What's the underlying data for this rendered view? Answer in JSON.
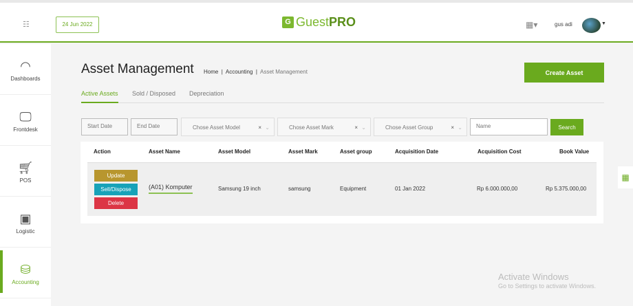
{
  "header": {
    "date": "24 Jun 2022",
    "logo": {
      "prefix": "G",
      "guest": "Guest",
      "pro": "PRO"
    },
    "user": "gus adi"
  },
  "sidebar": {
    "items": [
      {
        "label": "Dashboards",
        "icon": "gauge-icon"
      },
      {
        "label": "Frontdesk",
        "icon": "monitor-icon"
      },
      {
        "label": "POS",
        "icon": "cart-icon"
      },
      {
        "label": "Logistic",
        "icon": "box-icon"
      },
      {
        "label": "Accounting",
        "icon": "money-icon",
        "active": true
      }
    ]
  },
  "page": {
    "title": "Asset Management",
    "breadcrumb": [
      "Home",
      "Accounting",
      "Asset Management"
    ],
    "create_label": "Create Asset"
  },
  "tabs": [
    "Active Assets",
    "Sold / Disposed",
    "Depreciation"
  ],
  "filters": {
    "start_date": "Start Date",
    "end_date": "End Date",
    "model": "Chose Asset Model",
    "mark": "Chose Asset Mark",
    "group": "Chose Asset Group",
    "name": "Name",
    "search": "Search"
  },
  "table": {
    "headers": [
      "Action",
      "Asset Name",
      "Asset Model",
      "Asset Mark",
      "Asset group",
      "Acquisition Date",
      "Acquisition Cost",
      "Book Value"
    ],
    "rows": [
      {
        "actions": [
          "Update",
          "Sell/Dispose",
          "Delete"
        ],
        "name": "(A01) Komputer",
        "model": "Samsung 19 inch",
        "mark": "samsung",
        "group": "Equipment",
        "date": "01 Jan 2022",
        "cost": "Rp 6.000.000,00",
        "book": "Rp 5.375.000,00"
      }
    ]
  },
  "watermark": {
    "title": "Activate Windows",
    "sub": "Go to Settings to activate Windows."
  },
  "colors": {
    "accent": "#6aaa1e",
    "update": "#b8962e",
    "sell": "#17a2b8",
    "delete": "#dc3545"
  }
}
